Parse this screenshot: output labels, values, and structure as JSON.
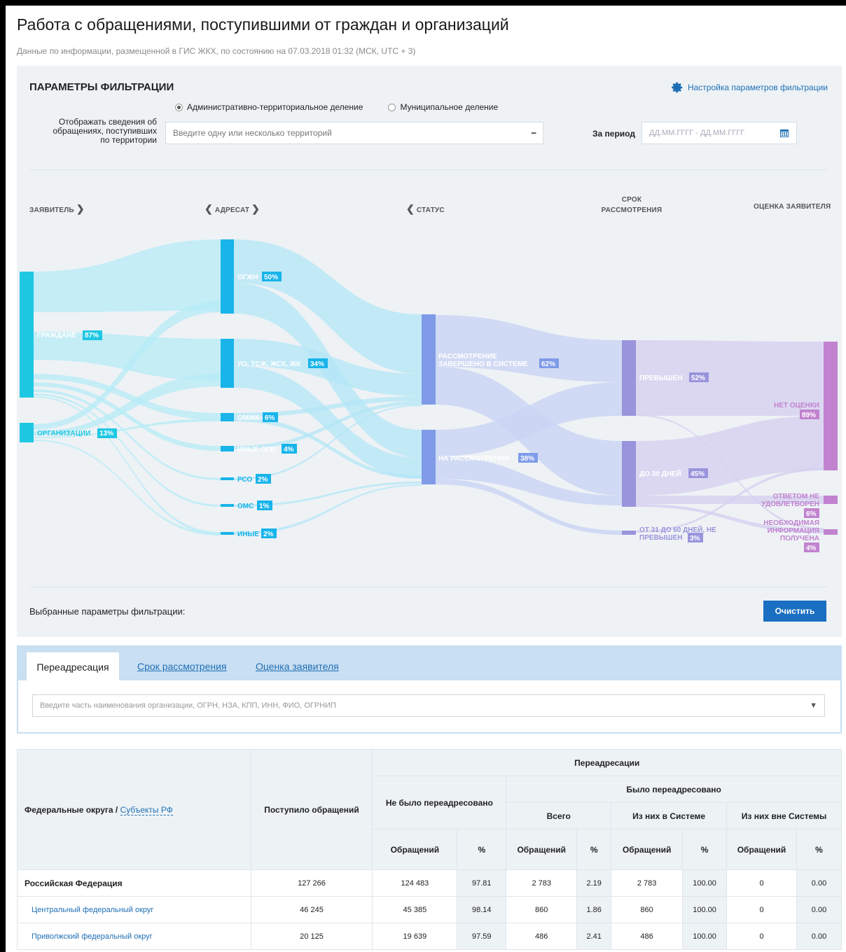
{
  "header": {
    "title": "Работа с обращениями, поступившими от граждан и организаций",
    "subtitle": "Данные по информации, размещенной в ГИС ЖКХ, по состоянию на 07.03.2018 01:32 (МСК, UTC + 3)"
  },
  "filters": {
    "title": "ПАРАМЕТРЫ ФИЛЬТРАЦИИ",
    "settings_link": "Настройка параметров фильтрации",
    "radio_admin": "Административно-территориальное деление",
    "radio_municipal": "Муниципальное деление",
    "territory_label": "Отображать сведения об обращениях, поступивших по территории",
    "territory_placeholder": "Введите одну или несколько территорий",
    "territory_more": "▪▪▪",
    "period_label": "За период",
    "period_placeholder": "ДД.ММ.ГГГГ - ДД.ММ.ГГГГ",
    "selected_params_label": "Выбранные параметры фильтрации:",
    "clear_button": "Очистить"
  },
  "sankey": {
    "columns": {
      "applicant": "ЗАЯВИТЕЛЬ",
      "addressee": "АДРЕСАТ",
      "status": "СТАТУС",
      "term_line1": "СРОК",
      "term_line2": "РАССМОТРЕНИЯ",
      "rating": "ОЦЕНКА ЗАЯВИТЕЛЯ"
    },
    "colors": {
      "applicant": "#1ec8e3",
      "addressee": "#18b4ea",
      "status": "#7f9be8",
      "term": "#9a94dc",
      "rating": "#c183cf"
    },
    "nodes": {
      "citizens": {
        "label": "ГРАЖДАНЕ",
        "pct": "87%"
      },
      "orgs": {
        "label": "ОРГАНИЗАЦИИ",
        "pct": "13%"
      },
      "ogzh": {
        "label": "ОГЖН",
        "pct": "50%"
      },
      "uo": {
        "label": "УО, ТСЖ, ЖСК, ЖК",
        "pct": "34%"
      },
      "omzhk": {
        "label": "ОМЖК",
        "pct": "6%"
      },
      "other_ogv": {
        "label": "ИНЫЕ ОГВ",
        "pct": "4%"
      },
      "rso": {
        "label": "РСО",
        "pct": "2%"
      },
      "oms": {
        "label": "ОМС",
        "pct": "1%"
      },
      "other": {
        "label": "ИНЫЕ",
        "pct": "2%"
      },
      "done_l1": "РАССМОТРЕНИЕ",
      "done_l2": "ЗАВЕРШЕНО В СИСТЕМЕ",
      "done_pct": "62%",
      "in_review": {
        "label": "НА РАССМОТРЕНИИ",
        "pct": "38%"
      },
      "exceeded": {
        "label": "ПРЕВЫШЕН",
        "pct": "52%"
      },
      "upto30": {
        "label": "ДО 30 ДНЕЙ",
        "pct": "45%"
      },
      "d31_60_l1": "ОТ 31 ДО 60 ДНЕЙ, НЕ",
      "d31_60_l2": "ПРЕВЫШЕН",
      "d31_60_pct": "3%",
      "no_rating": {
        "label": "НЕТ ОЦЕНКИ",
        "pct": "89%"
      },
      "not_sat_l1": "ОТВЕТОМ НЕ",
      "not_sat_l2": "УДОВЛЕТВОРЕН",
      "not_sat_pct": "6%",
      "info_l1": "НЕОБХОДИМАЯ",
      "info_l2": "ИНФОРМАЦИЯ",
      "info_l3": "ПОЛУЧЕНА",
      "info_pct": "4%"
    }
  },
  "tabs": {
    "items": [
      "Переадресация",
      "Срок рассмотрения",
      "Оценка заявителя"
    ],
    "org_placeholder": "Введите часть наименования организации, ОГРН, НЗА, КПП, ИНН, ФИО, ОГРНИП"
  },
  "table": {
    "h_district": "Федеральные округа / ",
    "h_subjects": "Субъекты РФ",
    "h_received": "Поступило обращений",
    "h_redirects": "Переадресации",
    "h_not_redirected": "Не было переадресовано",
    "h_redirected": "Было переадресовано",
    "h_total": "Всего",
    "h_in_system": "Из них в Системе",
    "h_out_system": "Из них вне Системы",
    "h_count": "Обращений",
    "h_pct": "%",
    "rows": [
      {
        "name": "Российская Федерация",
        "received": "127 266",
        "nr_n": "124 483",
        "nr_p": "97.81",
        "t_n": "2 783",
        "t_p": "2.19",
        "in_n": "2 783",
        "in_p": "100.00",
        "out_n": "0",
        "out_p": "0.00"
      },
      {
        "name": "Центральный федеральный округ",
        "received": "46 245",
        "nr_n": "45 385",
        "nr_p": "98.14",
        "t_n": "860",
        "t_p": "1.86",
        "in_n": "860",
        "in_p": "100.00",
        "out_n": "0",
        "out_p": "0.00"
      },
      {
        "name": "Приволжский федеральный округ",
        "received": "20 125",
        "nr_n": "19 639",
        "nr_p": "97.59",
        "t_n": "486",
        "t_p": "2.41",
        "in_n": "486",
        "in_p": "100.00",
        "out_n": "0",
        "out_p": "0.00"
      }
    ]
  }
}
